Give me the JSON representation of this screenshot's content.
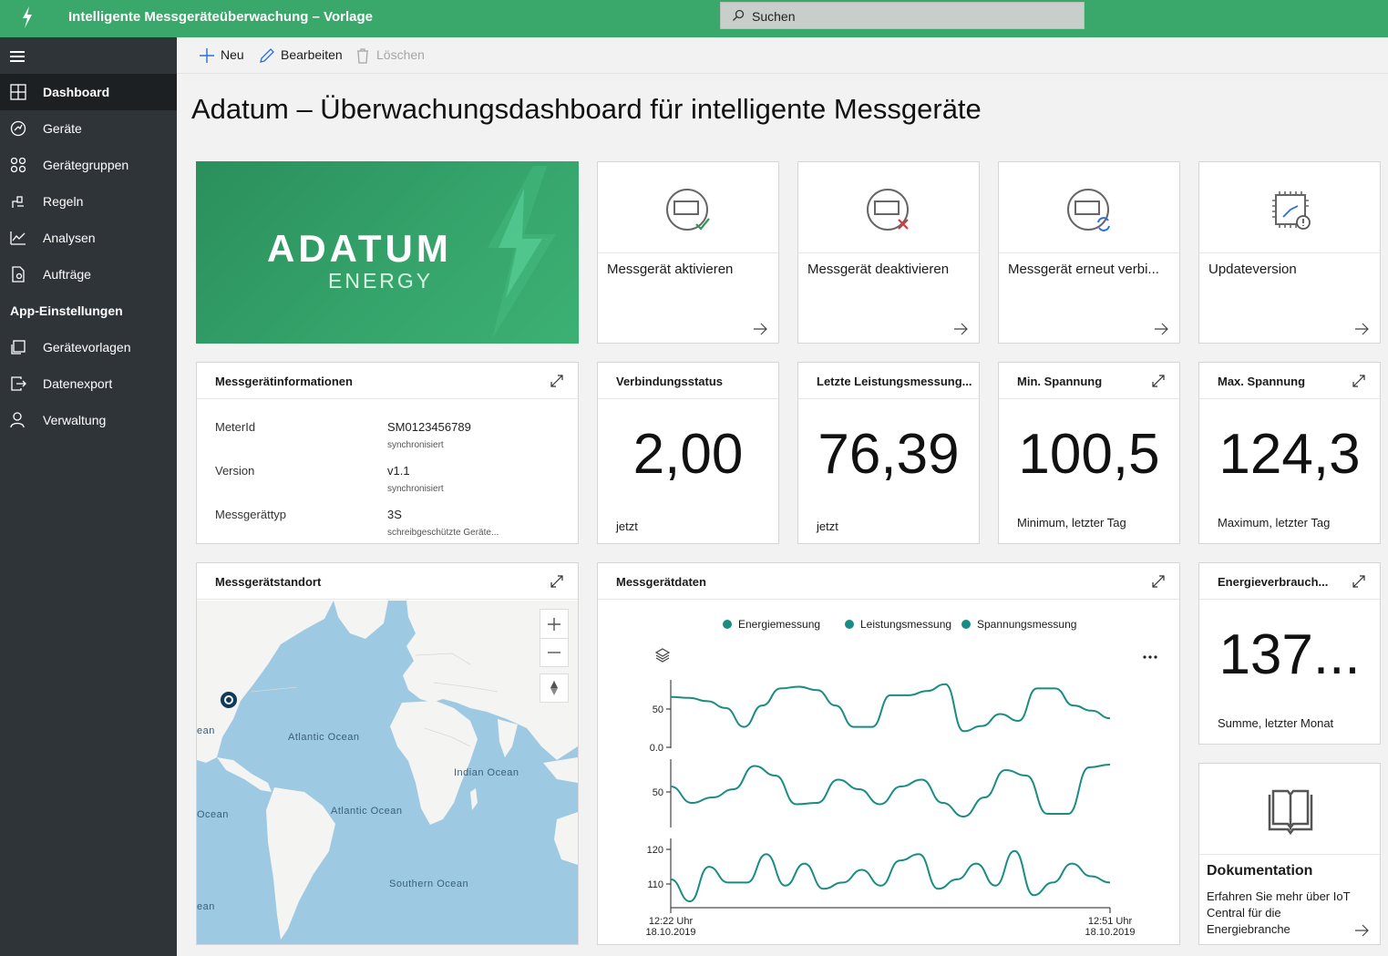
{
  "app": {
    "title": "Intelligente Messgeräteüberwachung – Vorlage",
    "search_placeholder": "Suchen",
    "accent": "#3aa86a"
  },
  "sidebar": {
    "items": [
      {
        "label": "Dashboard",
        "icon": "dashboard-icon",
        "active": true
      },
      {
        "label": "Geräte",
        "icon": "devices-icon"
      },
      {
        "label": "Gerätegruppen",
        "icon": "device-groups-icon"
      },
      {
        "label": "Regeln",
        "icon": "rules-icon"
      },
      {
        "label": "Analysen",
        "icon": "analytics-icon"
      },
      {
        "label": "Aufträge",
        "icon": "jobs-icon"
      }
    ],
    "section": "App-Einstellungen",
    "settings": [
      {
        "label": "Gerätevorlagen",
        "icon": "device-templates-icon"
      },
      {
        "label": "Datenexport",
        "icon": "data-export-icon"
      },
      {
        "label": "Verwaltung",
        "icon": "administration-icon"
      }
    ]
  },
  "commands": {
    "new": "Neu",
    "edit": "Bearbeiten",
    "delete": "Löschen"
  },
  "page_title": "Adatum – Überwachungsdashboard für intelligente Messgeräte",
  "logo": {
    "word": "ADATUM",
    "sub": "ENERGY"
  },
  "actions": [
    {
      "label": "Messgerät aktivieren",
      "icon": "meter-activate-icon"
    },
    {
      "label": "Messgerät deaktivieren",
      "icon": "meter-deactivate-icon"
    },
    {
      "label": "Messgerät erneut verbi...",
      "icon": "meter-reconnect-icon"
    },
    {
      "label": "Updateversion",
      "icon": "firmware-update-icon"
    }
  ],
  "info_tile": {
    "title": "Messgerätinformationen",
    "rows": [
      {
        "label": "MeterId",
        "value": "SM0123456789",
        "sub": "synchronisiert"
      },
      {
        "label": "Version",
        "value": "v1.1",
        "sub": "synchronisiert"
      },
      {
        "label": "Messgerättyp",
        "value": "3S",
        "sub": "schreibgeschützte Geräte..."
      }
    ]
  },
  "kpis": [
    {
      "title": "Verbindungsstatus",
      "value": "2,00",
      "sub": "jetzt"
    },
    {
      "title": "Letzte Leistungsmessung...",
      "value": "76,39",
      "sub": "jetzt"
    },
    {
      "title": "Min. Spannung",
      "value": "100,5",
      "sub": "Minimum, letzter Tag"
    },
    {
      "title": "Max. Spannung",
      "value": "124,3",
      "sub": "Maximum, letzter Tag"
    }
  ],
  "energy_kpi": {
    "title": "Energieverbrauch...",
    "value": "137...",
    "sub": "Summe, letzter Monat"
  },
  "map": {
    "title": "Messgerätstandort",
    "labels": [
      "Atlantic Ocean",
      "Indian Ocean",
      "Atlantic Ocean",
      "Southern Ocean",
      "ean",
      "Ocean",
      "ean"
    ]
  },
  "documentation": {
    "title": "Dokumentation",
    "body": "Erfahren Sie mehr über IoT Central für die Energiebranche"
  },
  "chart_data": {
    "type": "line",
    "title": "Messgerätdaten",
    "legend": [
      "Energiemessung",
      "Leistungsmessung",
      "Spannungsmessung"
    ],
    "legend_position": "top",
    "series_color": "#1a8c84",
    "x_labels": [
      {
        "time": "12:22 Uhr",
        "date": "18.10.2019"
      },
      {
        "time": "12:51 Uhr",
        "date": "18.10.2019"
      }
    ],
    "panels": [
      {
        "name": "Energiemessung",
        "yticks": [
          "50",
          "0.0"
        ],
        "ylim": [
          0,
          80
        ],
        "values": [
          60,
          59,
          55,
          47,
          25,
          50,
          70,
          72,
          68,
          50,
          25,
          25,
          62,
          62,
          67,
          75,
          20,
          26,
          40,
          32,
          70,
          70,
          50,
          44,
          35
        ]
      },
      {
        "name": "Leistungsmessung",
        "yticks": [
          "50"
        ],
        "ylim": [
          20,
          70
        ],
        "values": [
          50,
          38,
          42,
          48,
          65,
          58,
          37,
          38,
          55,
          48,
          37,
          50,
          55,
          38,
          28,
          42,
          62,
          58,
          30,
          30,
          64,
          66
        ]
      },
      {
        "name": "Spannungsmessung",
        "yticks": [
          "120",
          "110"
        ],
        "ylim": [
          104,
          126
        ],
        "values": [
          113,
          106,
          117,
          112,
          112,
          121,
          111,
          118,
          110,
          112,
          116,
          111,
          119,
          121,
          110,
          113,
          118,
          111,
          122,
          108,
          112,
          118,
          114,
          112
        ]
      }
    ]
  }
}
